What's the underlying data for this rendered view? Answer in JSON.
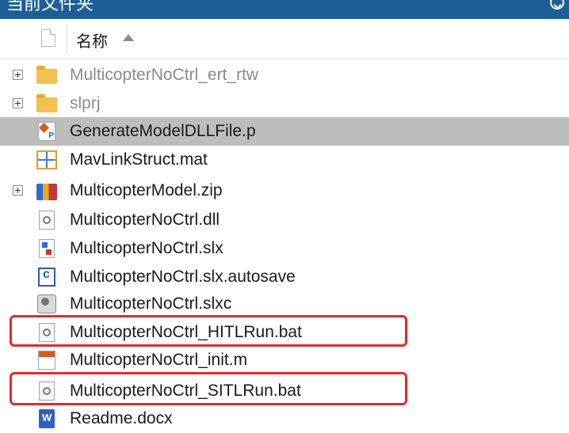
{
  "title": "当前文件夹",
  "header": {
    "name_label": "名称"
  },
  "files": [
    {
      "name": "MulticopterNoCtrl_ert_rtw",
      "icon": "folder-icon",
      "expandable": true,
      "dim": true
    },
    {
      "name": "slprj",
      "icon": "folder-icon",
      "expandable": true,
      "dim": true
    },
    {
      "name": "GenerateModelDLLFile.p",
      "icon": "p-file-icon",
      "selected": true
    },
    {
      "name": "MavLinkStruct.mat",
      "icon": "mat-file-icon"
    },
    {
      "name": "MulticopterModel.zip",
      "icon": "zip-file-icon",
      "expandable": true
    },
    {
      "name": "MulticopterNoCtrl.dll",
      "icon": "dll-file-icon"
    },
    {
      "name": "MulticopterNoCtrl.slx",
      "icon": "slx-file-icon"
    },
    {
      "name": "MulticopterNoCtrl.slx.autosave",
      "icon": "autosave-file-icon"
    },
    {
      "name": "MulticopterNoCtrl.slxc",
      "icon": "slxc-file-icon"
    },
    {
      "name": "MulticopterNoCtrl_HITLRun.bat",
      "icon": "bat-file-icon",
      "highlighted": true
    },
    {
      "name": "MulticopterNoCtrl_init.m",
      "icon": "m-file-icon"
    },
    {
      "name": "MulticopterNoCtrl_SITLRun.bat",
      "icon": "bat-file-icon",
      "highlighted": true
    },
    {
      "name": "Readme.docx",
      "icon": "docx-file-icon"
    }
  ],
  "colors": {
    "title_bar": "#1e5e98",
    "selection": "#bdbdbd",
    "highlight_box": "#e8282c"
  }
}
